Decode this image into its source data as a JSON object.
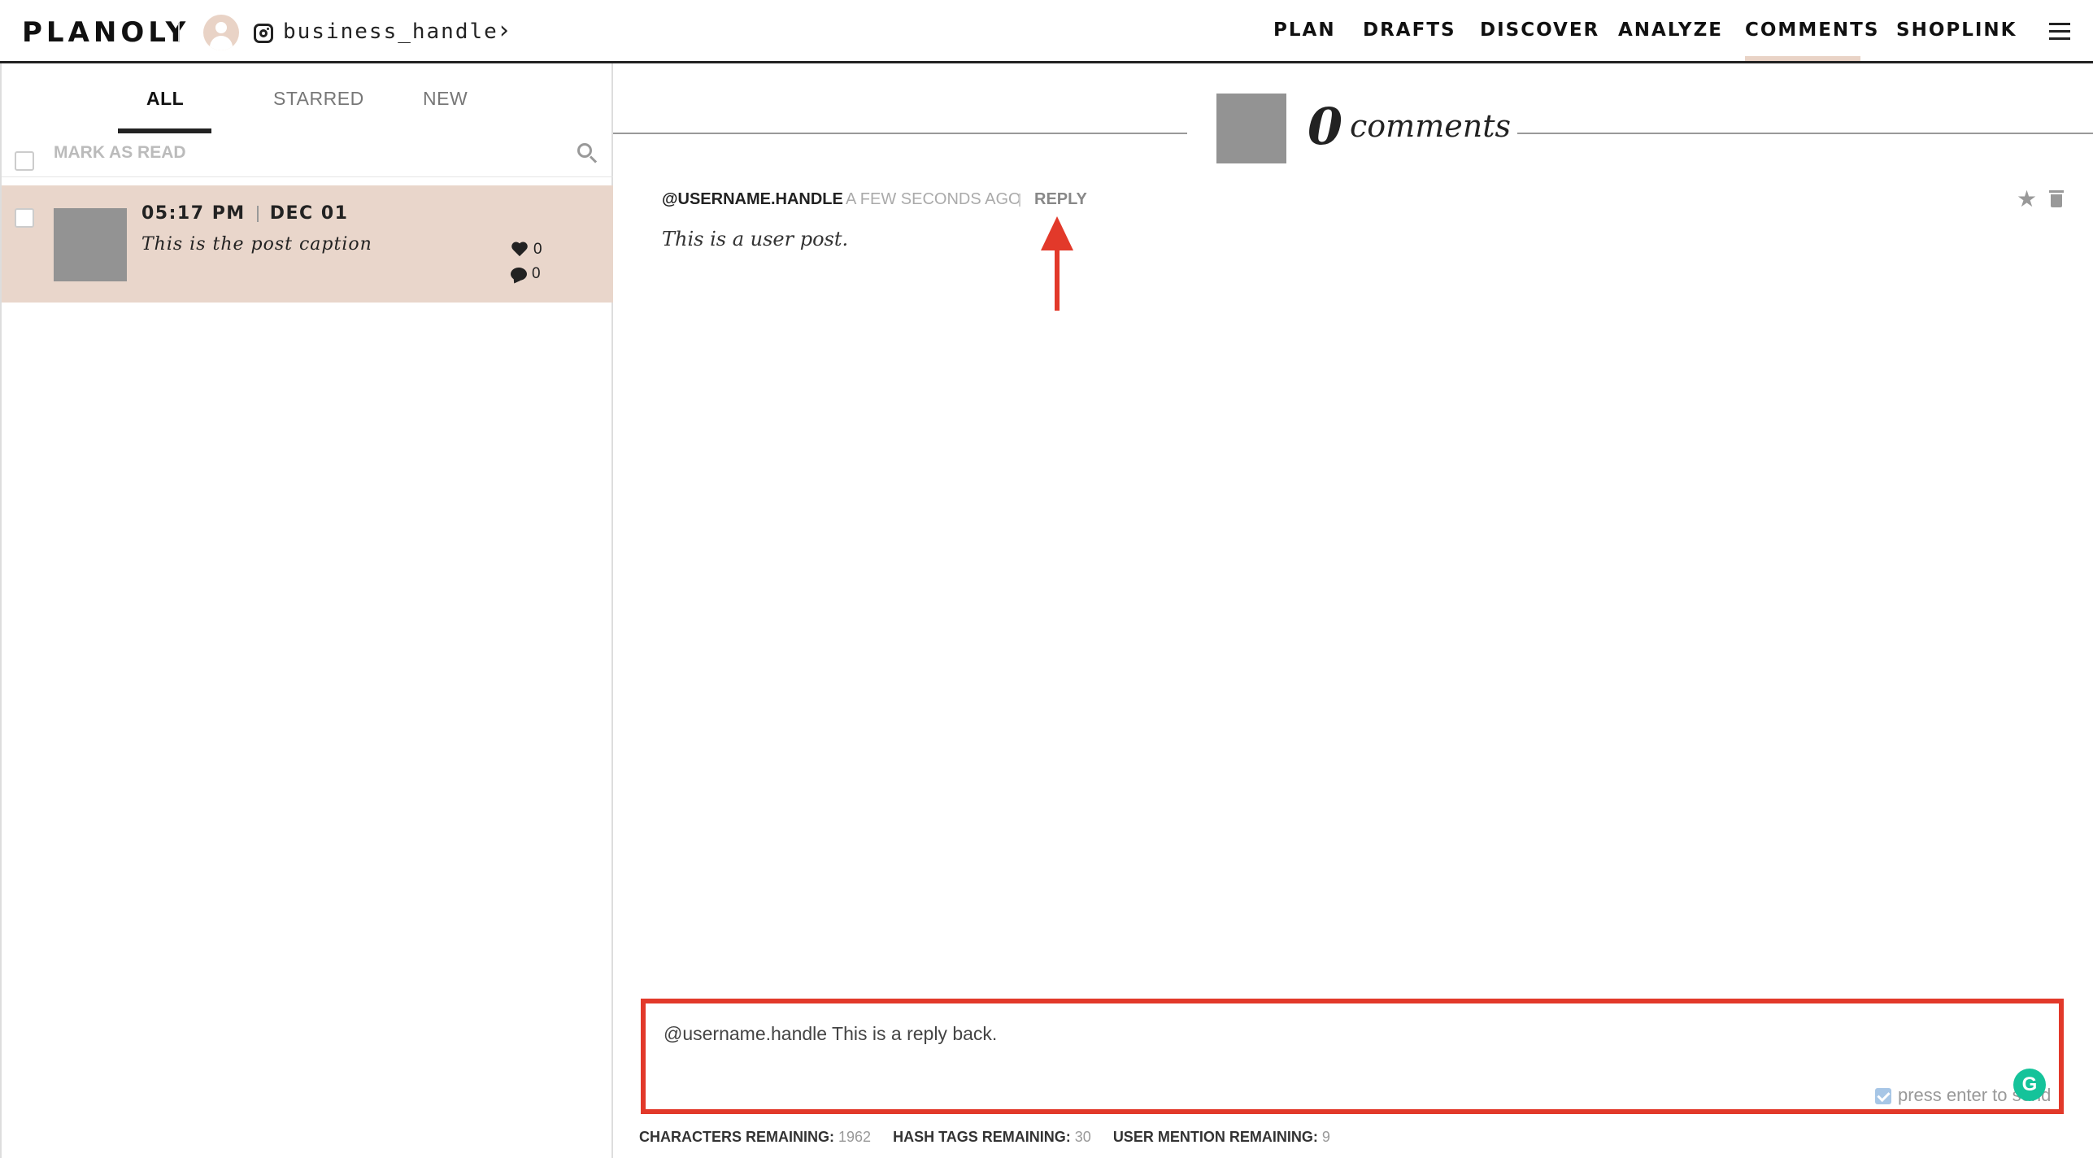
{
  "header": {
    "logo": "PLANOLY",
    "account_handle": "business_handle",
    "nav": [
      "PLAN",
      "DRAFTS",
      "DISCOVER",
      "ANALYZE",
      "COMMENTS",
      "SHOPLINK"
    ],
    "active_nav": "COMMENTS"
  },
  "tabs": [
    {
      "label": "ALL",
      "active": true
    },
    {
      "label": "STARRED",
      "active": false
    },
    {
      "label": "NEW",
      "active": false
    }
  ],
  "toolbar": {
    "mark_as_read": "MARK AS READ"
  },
  "posts": [
    {
      "time": "05:17 PM",
      "date": "DEC 01",
      "caption": "This is the post caption",
      "likes": "0",
      "comments": "0"
    }
  ],
  "comments_panel": {
    "count": "0",
    "label": "comments"
  },
  "comment": {
    "author": "@USERNAME.HANDLE",
    "time": "A FEW SECONDS AGO",
    "reply_label": "REPLY",
    "text": "This is a user post."
  },
  "reply_box": {
    "value": "@username.handle This is a reply back.",
    "send_option": "press enter to send",
    "send_checked": true
  },
  "limits": {
    "characters_label": "CHARACTERS REMAINING:",
    "characters_value": "1962",
    "hashtags_label": "HASH TAGS REMAINING:",
    "hashtags_value": "30",
    "mentions_label": "USER MENTION REMAINING:",
    "mentions_value": "9"
  },
  "colors": {
    "accent": "#e9d3c6",
    "highlight": "#e2392a",
    "selected_row": "#e9d6cb"
  }
}
